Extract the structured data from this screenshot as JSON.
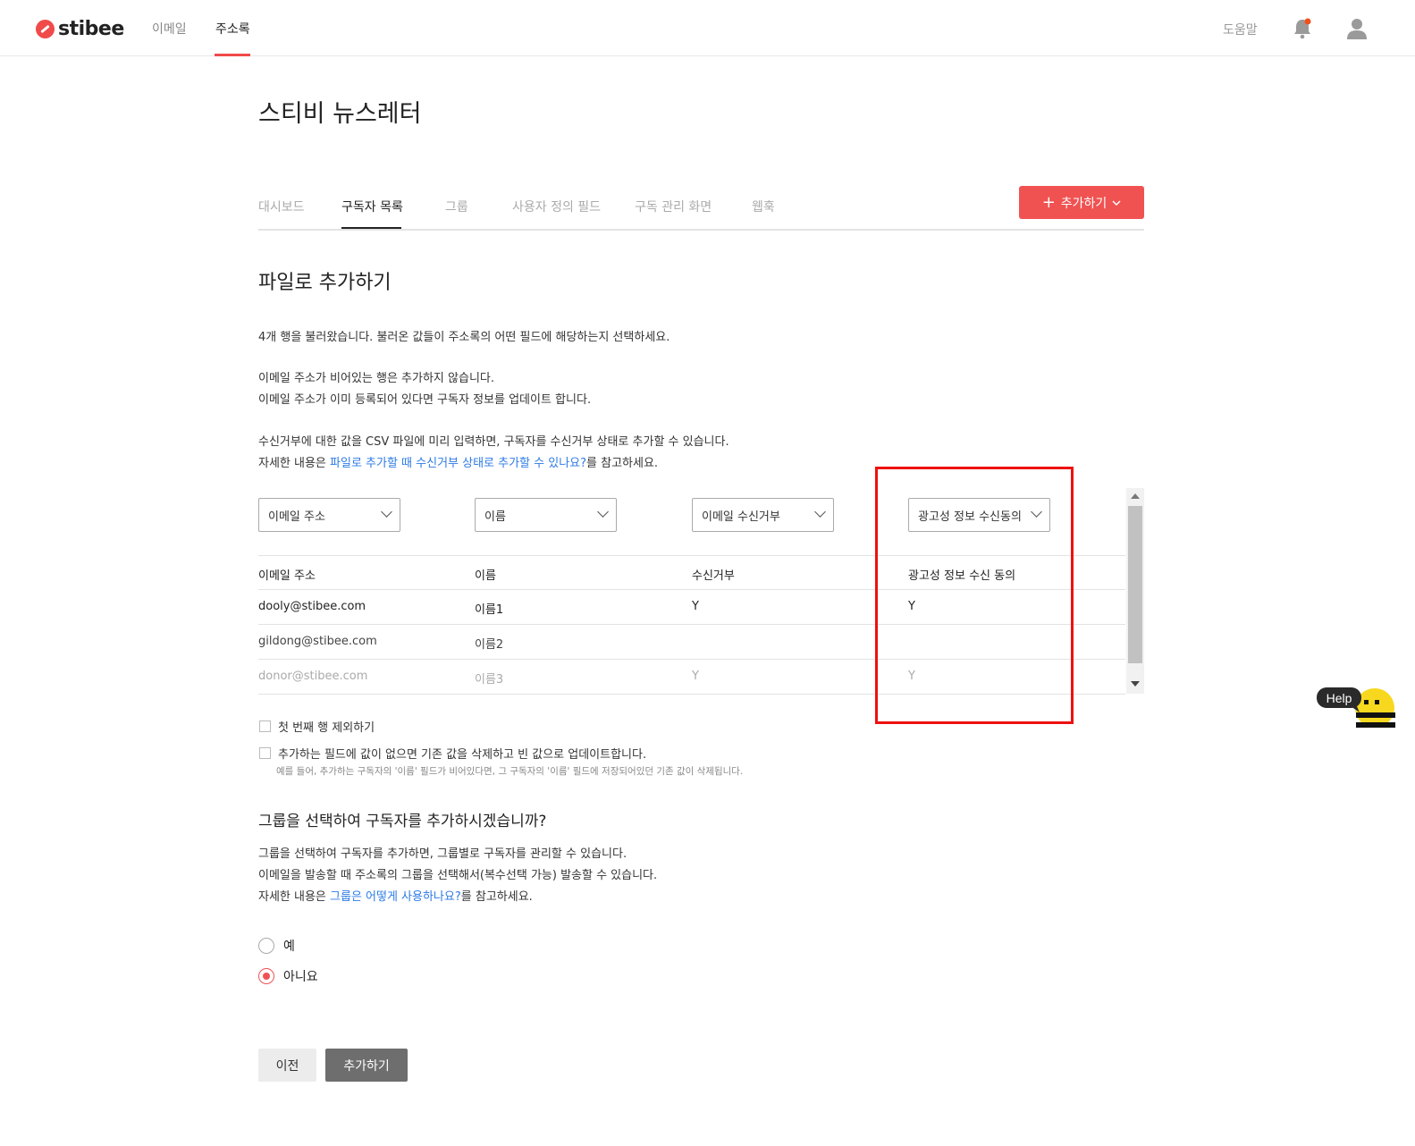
{
  "brand": {
    "name": "stibee",
    "accent": "#f05252"
  },
  "topnav": {
    "items": [
      {
        "label": "이메일"
      },
      {
        "label": "주소록"
      }
    ],
    "help_label": "도움말"
  },
  "page": {
    "title": "스티비 뉴스레터"
  },
  "subtabs": [
    {
      "label": "대시보드"
    },
    {
      "label": "구독자 목록"
    },
    {
      "label": "그룹"
    },
    {
      "label": "사용자 정의 필드"
    },
    {
      "label": "구독 관리 화면"
    },
    {
      "label": "웹훅"
    }
  ],
  "add_button": {
    "label": "추가하기"
  },
  "section": {
    "title": "파일로 추가하기",
    "p1": "4개 행을 불러왔습니다. 불러온 값들이 주소록의 어떤 필드에 해당하는지 선택하세요.",
    "p2a": "이메일 주소가 비어있는 행은 추가하지 않습니다.",
    "p2b": "이메일 주소가 이미 등록되어 있다면 구독자 정보를 업데이트 합니다.",
    "p3a": "수신거부에 대한 값을 CSV 파일에 미리 입력하면, 구독자를 수신거부 상태로 추가할 수 있습니다.",
    "p3b_prefix": "자세한 내용은 ",
    "p3b_link": "파일로 추가할 때 수신거부 상태로 추가할 수 있나요?",
    "p3b_suffix": "를 참고하세요."
  },
  "mapping_selects": [
    {
      "value": "이메일 주소"
    },
    {
      "value": "이름"
    },
    {
      "value": "이메일 수신거부"
    },
    {
      "value": "광고성 정보 수신동의"
    }
  ],
  "preview_table": {
    "headers": [
      "이메일 주소",
      "이름",
      "수신거부",
      "광고성 정보 수신 동의"
    ],
    "rows": [
      [
        "dooly@stibee.com",
        "이름1",
        "Y",
        "Y"
      ],
      [
        "gildong@stibee.com",
        "이름2",
        "",
        ""
      ],
      [
        "donor@stibee.com",
        "이름3",
        "Y",
        "Y"
      ]
    ]
  },
  "options": {
    "exclude_first_row": "첫 번째 행 제외하기",
    "overwrite_empty": "추가하는 필드에 값이 없으면 기존 값을 삭제하고 빈 값으로 업데이트합니다.",
    "overwrite_note": "예를 들어, 추가하는 구독자의 '이름' 필드가 비어있다면, 그 구독자의 '이름' 필드에 저장되어있던 기존 값이 삭제됩니다."
  },
  "group": {
    "title": "그룹을 선택하여 구독자를 추가하시겠습니까?",
    "p1": "그룹을 선택하여 구독자를 추가하면, 그룹별로 구독자를 관리할 수 있습니다.",
    "p2": "이메일을 발송할 때 주소록의 그룹을 선택해서(복수선택 가능) 발송할 수 있습니다.",
    "p3_prefix": "자세한 내용은 ",
    "p3_link": "그룹은 어떻게 사용하나요?",
    "p3_suffix": "를 참고하세요.",
    "radio_yes": "예",
    "radio_no": "아니요",
    "selected": "아니요"
  },
  "footer_buttons": {
    "prev": "이전",
    "submit": "추가하기"
  },
  "help_widget": {
    "label": "Help"
  }
}
